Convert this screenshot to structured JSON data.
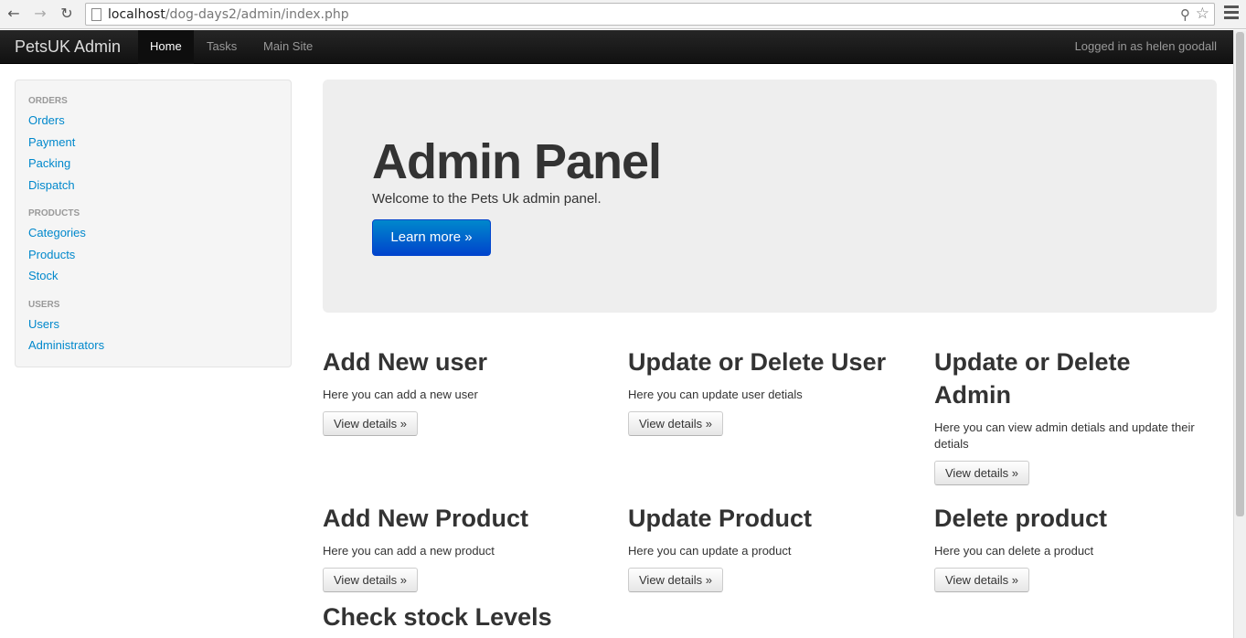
{
  "browser": {
    "url_host": "localhost",
    "url_path": "/dog-days2/admin/index.php",
    "back_icon": "arrow-left-icon",
    "forward_icon": "arrow-right-icon",
    "reload_icon": "reload-icon"
  },
  "navbar": {
    "brand": "PetsUK Admin",
    "items": [
      {
        "label": "Home",
        "active": true
      },
      {
        "label": "Tasks",
        "active": false
      },
      {
        "label": "Main Site",
        "active": false
      }
    ],
    "logged_in": "Logged in as helen goodall"
  },
  "sidebar": {
    "sections": [
      {
        "header": "ORDERS",
        "links": [
          "Orders",
          "Payment",
          "Packing",
          "Dispatch"
        ]
      },
      {
        "header": "PRODUCTS",
        "links": [
          "Categories",
          "Products",
          "Stock"
        ]
      },
      {
        "header": "USERS",
        "links": [
          "Users",
          "Administrators"
        ]
      }
    ]
  },
  "hero": {
    "title": "Admin Panel",
    "subtitle": "Welcome to the Pets Uk admin panel.",
    "button": "Learn more »"
  },
  "cards": [
    {
      "title": "Add New user",
      "text": "Here you can add a new user",
      "button": "View details »"
    },
    {
      "title": "Update or Delete User",
      "text": "Here you can update user detials",
      "button": "View details »"
    },
    {
      "title": "Update or Delete Admin",
      "text": "Here you can view admin detials and update their detials",
      "button": "View details »"
    },
    {
      "title": "Add New Product",
      "text": "Here you can add a new product",
      "button": "View details »"
    },
    {
      "title": "Update Product",
      "text": "Here you can update a product",
      "button": "View details »"
    },
    {
      "title": "Delete product",
      "text": "Here you can delete a product",
      "button": "View details »"
    },
    {
      "title": "Check stock Levels"
    }
  ],
  "colors": {
    "link": "#0088cc",
    "primary_button": "#0066cc",
    "navbar": "#1b1b1b"
  }
}
